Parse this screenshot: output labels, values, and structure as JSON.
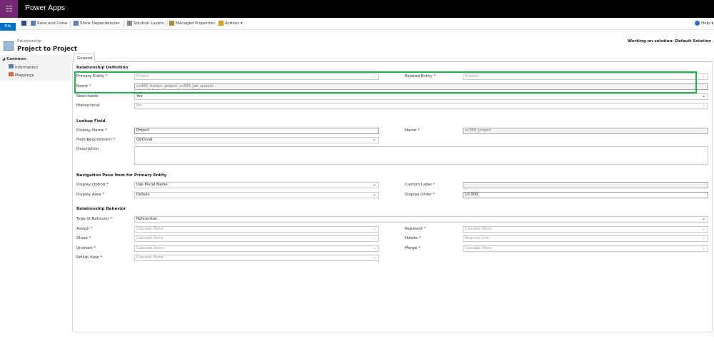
{
  "app": {
    "title": "Power Apps",
    "waffle_icon": "waffle-icon"
  },
  "toolbar": {
    "file": "File",
    "save": "Save and Close",
    "deps": "Show Dependencies",
    "layers": "Solution Layers",
    "managed": "Managed Properties",
    "actions": "Actions",
    "help": "Help"
  },
  "header": {
    "entity_type": "Relationship",
    "title": "Project to Project",
    "solution": "Working on solution: Default Solution"
  },
  "nav": {
    "group": "Common",
    "items": [
      "Information",
      "Mappings"
    ]
  },
  "tabs": {
    "general": "General"
  },
  "sections": {
    "definition": {
      "title": "Relationship Definition",
      "primary_label": "Primary Entity",
      "primary_value": "Project",
      "related_label": "Related Entity",
      "related_value": "Project",
      "name_label": "Name",
      "name_value": "vs360_msdyn_project_vs360_job_project",
      "searchable_label": "Searchable",
      "searchable_value": "Yes",
      "hierarchical_label": "Hierarchical",
      "hierarchical_value": "No"
    },
    "lookup": {
      "title": "Lookup Field",
      "display_name_label": "Display Name",
      "display_name_value": "Project",
      "name_label": "Name",
      "name_value": "vs360_project",
      "requirement_label": "Field Requirement",
      "requirement_value": "Optional",
      "description_label": "Description"
    },
    "nav_pane": {
      "title": "Navigation Pane Item for Primary Entity",
      "option_label": "Display Option",
      "option_value": "Use Plural Name",
      "custom_label": "Custom Label",
      "area_label": "Display Area",
      "area_value": "Details",
      "order_label": "Display Order",
      "order_value": "10,000"
    },
    "behavior": {
      "title": "Relationship Behavior",
      "type_label": "Type of Behavior",
      "type_value": "Referential",
      "assign_label": "Assign",
      "assign_value": "Cascade None",
      "reparent_label": "Reparent",
      "reparent_value": "Cascade None",
      "share_label": "Share",
      "share_value": "Cascade None",
      "delete_label": "Delete",
      "delete_value": "Remove Link",
      "unshare_label": "Unshare",
      "unshare_value": "Cascade None",
      "merge_label": "Merge",
      "merge_value": "Cascade None",
      "rollup_label": "Rollup View",
      "rollup_value": "Cascade None"
    }
  },
  "colors": {
    "highlight": "#22b14c",
    "file": "#0072c6",
    "brand": "#742774"
  }
}
